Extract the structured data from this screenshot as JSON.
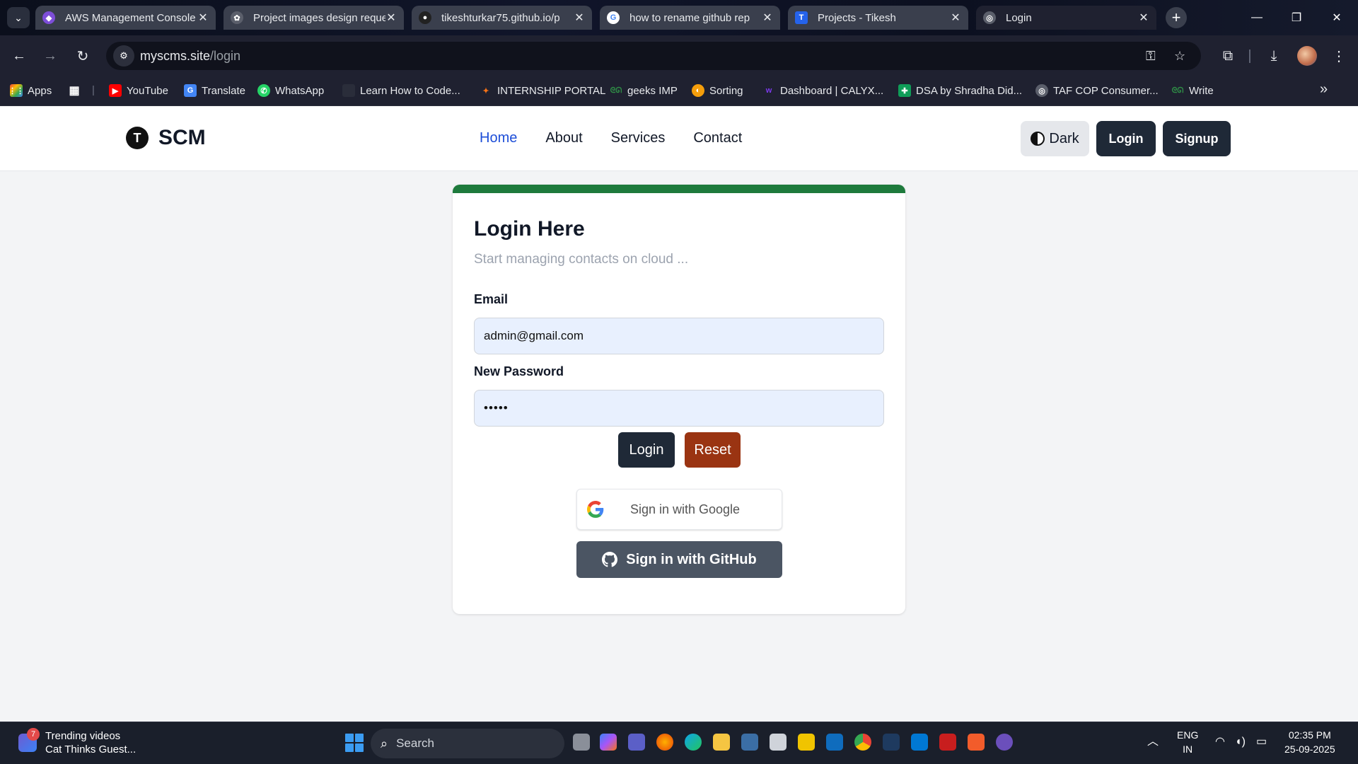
{
  "browser": {
    "tabs": [
      {
        "label": "AWS Management Console",
        "icon": "aws-icon",
        "color": "#7d4ed8"
      },
      {
        "label": "Project images design request",
        "icon": "chatgpt-icon",
        "color": "#5b5f6b"
      },
      {
        "label": "tikeshturkar75.github.io/p",
        "icon": "github-icon",
        "color": "#222222"
      },
      {
        "label": "how to rename github rep",
        "icon": "google-icon",
        "color": "#ffffff"
      },
      {
        "label": "Projects - Tikesh",
        "icon": "tikesh-t-icon",
        "color": "#2563eb"
      },
      {
        "label": "Login",
        "icon": "globe-icon",
        "color": "#5b5f6b"
      }
    ],
    "close_glyph": "✕",
    "address": {
      "host": "myscms.site",
      "path": "/login"
    },
    "bookmarks": [
      {
        "label": "Apps",
        "icon": "apps-grid-icon"
      },
      {
        "label": "YouTube",
        "icon": "youtube-icon"
      },
      {
        "label": "Translate",
        "icon": "translate-icon"
      },
      {
        "label": "WhatsApp",
        "icon": "whatsapp-icon"
      },
      {
        "label": "Learn How to Code...",
        "icon": "page-icon"
      },
      {
        "label": "INTERNSHIP PORTAL",
        "icon": "internship-icon"
      },
      {
        "label": "geeks IMP",
        "icon": "geeks-icon"
      },
      {
        "label": "Sorting",
        "icon": "sorting-icon"
      },
      {
        "label": "Dashboard | CALYX...",
        "icon": "calyx-icon"
      },
      {
        "label": "DSA by Shradha Did...",
        "icon": "sheets-icon"
      },
      {
        "label": "TAF COP Consumer...",
        "icon": "globe-icon"
      },
      {
        "label": "Write",
        "icon": "geeks-icon"
      }
    ],
    "more_glyph": "»"
  },
  "site": {
    "brand": "SCM",
    "brand_logo_letter": "T",
    "nav": [
      "Home",
      "About",
      "Services",
      "Contact"
    ],
    "theme_button": "Dark",
    "login_button": "Login",
    "signup_button": "Signup"
  },
  "login_card": {
    "title": "Login Here",
    "subtitle": "Start managing contacts on cloud ...",
    "email_label": "Email",
    "email_value": "admin@gmail.com",
    "password_label": "New Password",
    "password_value": "•••••",
    "login_button": "Login",
    "reset_button": "Reset",
    "google_button": "Sign in with Google",
    "github_button": "Sign in with GitHub",
    "accent_color": "#1e7a3c"
  },
  "taskbar": {
    "widget_badge": "7",
    "widget_title": "Trending videos",
    "widget_subtitle": "Cat Thinks Guest...",
    "search_placeholder": "Search",
    "lang_line1": "ENG",
    "lang_line2": "IN",
    "time": "02:35 PM",
    "date": "25-09-2025"
  }
}
